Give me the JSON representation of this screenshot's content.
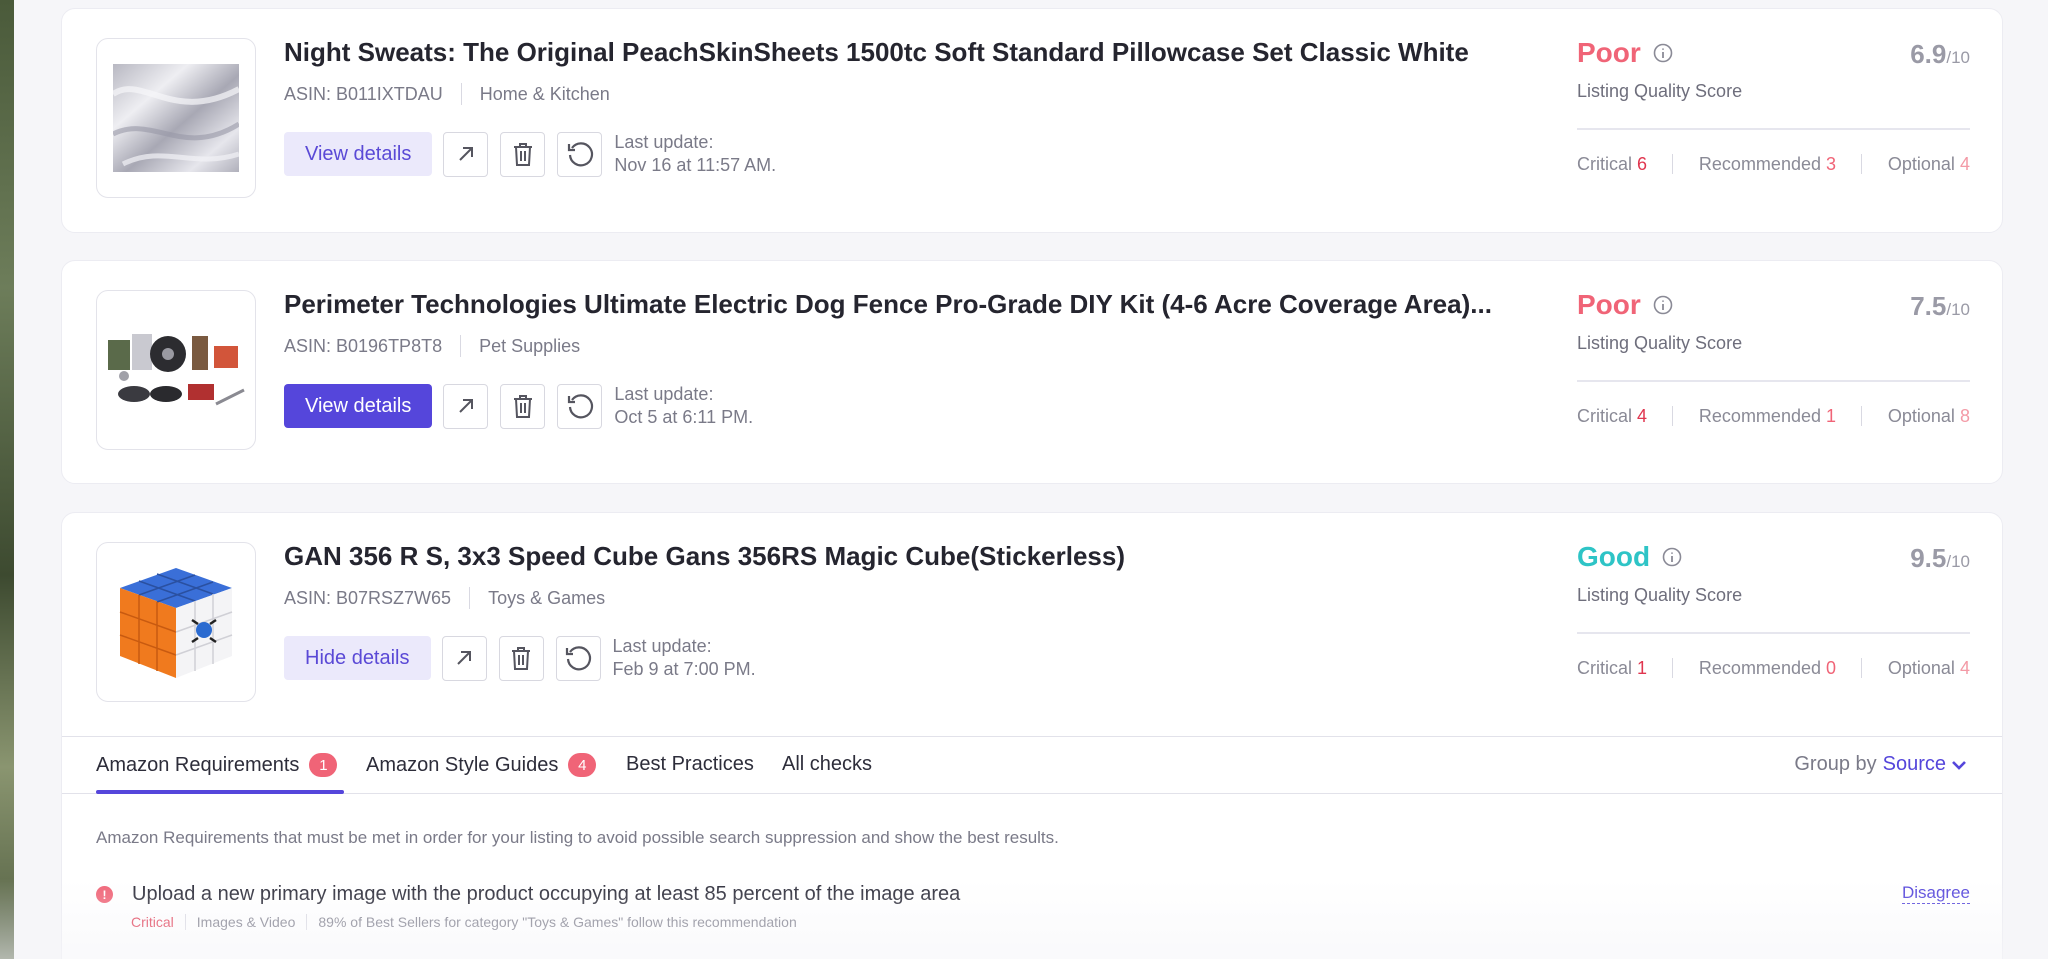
{
  "products": [
    {
      "title": "Night Sweats: The Original PeachSkinSheets 1500tc Soft Standard Pillowcase Set Classic White",
      "asin": "ASIN: B011IXTDAU",
      "category": "Home & Kitchen",
      "details_label": "View details",
      "last_update_label": "Last update:",
      "last_update_value": "Nov 16 at 11:57 AM.",
      "rating": "Poor",
      "score": "6.9",
      "score_den": "/10",
      "score_label": "Listing Quality Score",
      "critical_label": "Critical",
      "critical": "6",
      "recommended_label": "Recommended",
      "recommended": "3",
      "optional_label": "Optional",
      "optional": "4"
    },
    {
      "title": "Perimeter Technologies Ultimate Electric Dog Fence Pro-Grade DIY Kit (4-6 Acre Coverage Area)...",
      "asin": "ASIN: B0196TP8T8",
      "category": "Pet Supplies",
      "details_label": "View details",
      "last_update_label": "Last update:",
      "last_update_value": "Oct 5 at 6:11 PM.",
      "rating": "Poor",
      "score": "7.5",
      "score_den": "/10",
      "score_label": "Listing Quality Score",
      "critical_label": "Critical",
      "critical": "4",
      "recommended_label": "Recommended",
      "recommended": "1",
      "optional_label": "Optional",
      "optional": "8"
    },
    {
      "title": "GAN 356 R S, 3x3 Speed Cube Gans 356RS Magic Cube(Stickerless)",
      "asin": "ASIN: B07RSZ7W65",
      "category": "Toys & Games",
      "details_label": "Hide details",
      "last_update_label": "Last update:",
      "last_update_value": "Feb 9 at 7:00 PM.",
      "rating": "Good",
      "score": "9.5",
      "score_den": "/10",
      "score_label": "Listing Quality Score",
      "critical_label": "Critical",
      "critical": "1",
      "recommended_label": "Recommended",
      "recommended": "0",
      "optional_label": "Optional",
      "optional": "4"
    }
  ],
  "tabs": [
    {
      "label": "Amazon Requirements",
      "badge": "1"
    },
    {
      "label": "Amazon Style Guides",
      "badge": "4"
    },
    {
      "label": "Best Practices"
    },
    {
      "label": "All checks"
    }
  ],
  "group_by": {
    "label": "Group by",
    "value": "Source"
  },
  "description": "Amazon Requirements that must be met in order for your listing to avoid possible search suppression and show the best results.",
  "requirement": {
    "title": "Upload a new primary image with the product occupying at least 85 percent of the image area",
    "severity": "Critical",
    "category": "Images & Video",
    "note": "89% of Best Sellers for category \"Toys & Games\" follow this recommendation",
    "disagree_label": "Disagree",
    "indicator": "!"
  },
  "colors": {
    "primary": "#5546db",
    "poor": "#f06477",
    "good": "#2ec4c6",
    "critical": "#e0364f"
  },
  "icons": [
    "external-link-icon",
    "trash-icon",
    "refresh-icon",
    "info-icon",
    "chevron-down-icon",
    "alert-icon"
  ]
}
